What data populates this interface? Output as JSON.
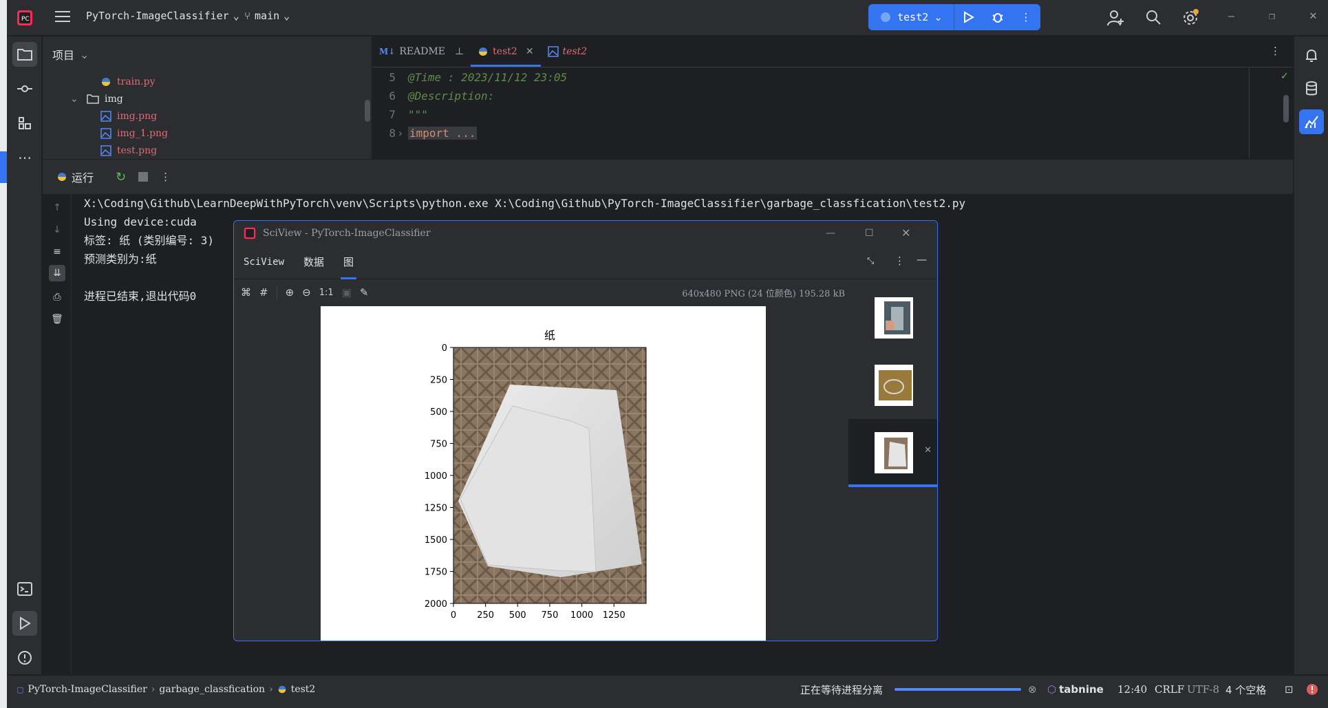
{
  "titlebar": {
    "project_name": "PyTorch-ImageClassifier",
    "branch": "main",
    "run_config": "test2"
  },
  "project_panel": {
    "title": "项目",
    "items": [
      {
        "label": "train.py",
        "type": "python",
        "color": "#e06c75"
      },
      {
        "label": "img",
        "type": "folder",
        "color": "#dfe1e5"
      },
      {
        "label": "img.png",
        "type": "image",
        "color": "#e06c75"
      },
      {
        "label": "img_1.png",
        "type": "image",
        "color": "#e06c75"
      },
      {
        "label": "test.png",
        "type": "image",
        "color": "#e06c75"
      }
    ]
  },
  "editor": {
    "tabs": [
      {
        "label": "README",
        "icon": "markdown-icon"
      },
      {
        "label": "test2",
        "icon": "python-icon",
        "selected": true
      },
      {
        "label": "test2",
        "icon": "image-icon"
      }
    ],
    "lines": [
      {
        "num": "5",
        "text": "@Time  : 2023/11/12 23:05"
      },
      {
        "num": "6",
        "text": "@Description:"
      },
      {
        "num": "7",
        "text": "\"\"\""
      },
      {
        "num": "8",
        "text": "import ..."
      }
    ]
  },
  "run_panel": {
    "title": "运行",
    "console": [
      "X:\\Coding\\Github\\LearnDeepWithPyTorch\\venv\\Scripts\\python.exe X:\\Coding\\Github\\PyTorch-ImageClassifier\\garbage_classfication\\test2.py",
      "Using device:cuda",
      "标签: 纸 (类别编号: 3)",
      "预测类别为:纸",
      "",
      "进程已结束,退出代码0"
    ]
  },
  "sciview": {
    "window_title": "SciView - PyTorch-ImageClassifier",
    "tabs": [
      "SciView",
      "数据",
      "图"
    ],
    "zoom_label": "1:1",
    "image_info": "640x480 PNG (24 位颜色) 195.28 kB"
  },
  "chart_data": {
    "type": "image",
    "title": "纸",
    "xlabel": "",
    "ylabel": "",
    "x_ticks": [
      "0",
      "250",
      "500",
      "750",
      "1000",
      "1250"
    ],
    "y_ticks": [
      "0",
      "250",
      "500",
      "750",
      "1000",
      "1250",
      "1500",
      "1750",
      "2000"
    ],
    "xlim": [
      0,
      1500
    ],
    "ylim": [
      2000,
      0
    ]
  },
  "statusbar": {
    "breadcrumb": [
      "PyTorch-ImageClassifier",
      "garbage_classfication",
      "test2"
    ],
    "process_text": "正在等待进程分离",
    "plugin": "tabnine",
    "position": "12:40",
    "line_sep": "CRLF",
    "encoding": "UTF-8",
    "indent": "4 个空格"
  },
  "colors": {
    "accent": "#3574f0",
    "background": "#1e1f22",
    "panel": "#2b2d30",
    "comment_green": "#5f8c4a"
  }
}
